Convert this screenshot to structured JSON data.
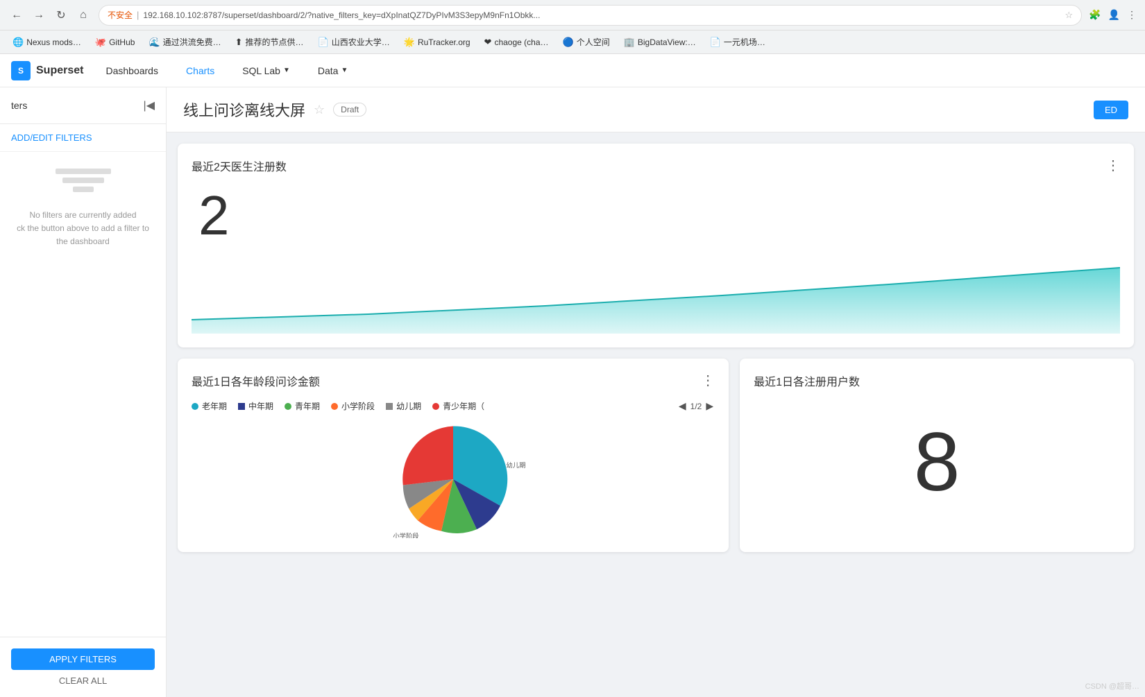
{
  "browser": {
    "warning_text": "不安全",
    "url": "192.168.10.102:8787/superset/dashboard/2/?native_filters_key=dXpInatQZ7DyPIvM3S3epyM9nFn1Obkk...",
    "controls": {
      "refresh": "↻",
      "home": "⌂",
      "back": "←",
      "forward": "→"
    }
  },
  "bookmarks": [
    {
      "label": "Nexus mods…",
      "icon": "🌐"
    },
    {
      "label": "GitHub",
      "icon": "🐙"
    },
    {
      "label": "通过洪流免费…",
      "icon": "🌊"
    },
    {
      "label": "推荐的节点供…",
      "icon": "⬆"
    },
    {
      "label": "山西农业大学…",
      "icon": "📄"
    },
    {
      "label": "RuTracker.org",
      "icon": "🌟"
    },
    {
      "label": "chaoge (cha…",
      "icon": "❤"
    },
    {
      "label": "个人空间",
      "icon": "🔵"
    },
    {
      "label": "BigDataView:…",
      "icon": "🏢"
    },
    {
      "label": "一元机场…",
      "icon": "📄"
    }
  ],
  "app": {
    "logo_text": "Superset",
    "nav_items": [
      {
        "label": "Dashboards",
        "active": false
      },
      {
        "label": "Charts",
        "active": true
      },
      {
        "label": "SQL Lab",
        "dropdown": true
      },
      {
        "label": "Data",
        "dropdown": true
      }
    ]
  },
  "sidebar": {
    "title": "ters",
    "add_filters_label": "ADD/EDIT FILTERS",
    "empty_text_line1": "No filters are currently added",
    "empty_text_line2": "ck the button above to add a filter to the dashboard",
    "apply_button": "APPLY FILTERS",
    "clear_button": "CLEAR ALL"
  },
  "dashboard": {
    "title": "线上问诊离线大屏",
    "draft_label": "Draft",
    "edit_button": "ED",
    "charts": [
      {
        "id": "chart1",
        "title": "最近2天医生注册数",
        "type": "big_number_area",
        "big_number": "2",
        "more_icon": "⋮"
      },
      {
        "id": "chart2",
        "title": "最近1日各年龄段问诊金额",
        "type": "pie",
        "more_icon": "⋮",
        "legend": [
          {
            "label": "老年期",
            "color": "#1DA8C4"
          },
          {
            "label": "中年期",
            "color": "#2D3B8E"
          },
          {
            "label": "青年期",
            "color": "#4CAF50"
          },
          {
            "label": "小学阶段",
            "color": "#FF6B2B"
          },
          {
            "label": "幼儿期",
            "color": "#888888"
          },
          {
            "label": "青少年期（",
            "color": "#E53935"
          }
        ],
        "legend_page": "1/2",
        "pie_labels": [
          "幼儿期",
          "小学阶段"
        ]
      },
      {
        "id": "chart3",
        "title": "最近1日各注册用户数",
        "type": "big_number",
        "big_number": "8"
      }
    ]
  },
  "csdn_watermark": "CSDN @超哥…"
}
